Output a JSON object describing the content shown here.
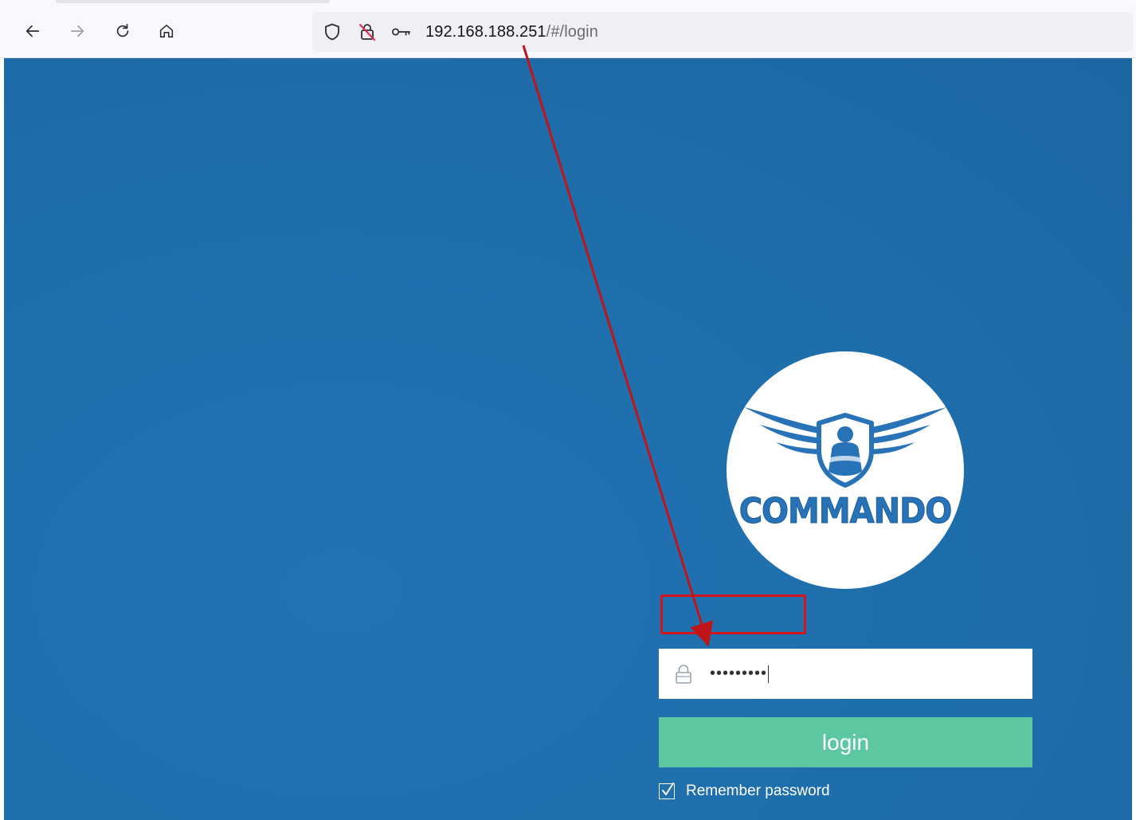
{
  "browser": {
    "url_host": "192.168.188.251",
    "url_path": "/#/login",
    "icons": [
      "back-arrow-icon",
      "forward-arrow-icon",
      "reload-icon",
      "home-icon",
      "shield-icon",
      "insecure-lock-icon",
      "key-icon"
    ]
  },
  "logo": {
    "brand_text": "COMMANDO",
    "emblem": "winged-shield-soldier-emblem"
  },
  "login_form": {
    "password_value": "•••••••••",
    "lock_icon": "lock-icon",
    "login_label": "login",
    "remember_label": "Remember password",
    "remember_checked": true
  },
  "colors": {
    "page_background": "#1f6fad",
    "login_button": "#5cc7a1",
    "annotation": "#d5151c",
    "logo_blue": "#2872b8"
  }
}
